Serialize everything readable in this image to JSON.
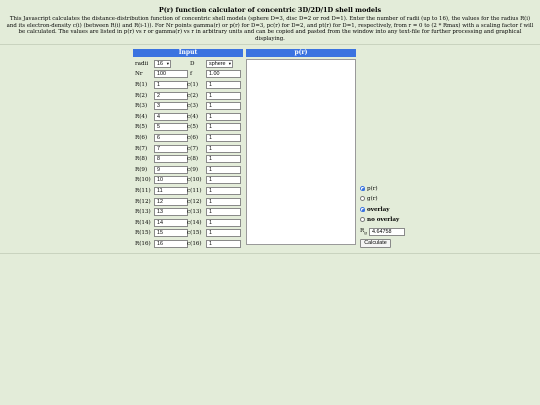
{
  "page": {
    "title": "P(r) function calculator of concentric 3D/2D/1D shell models",
    "description": "This Javascript calculates the distance-distribution function of concentric shell models (sphere D=3, disc D=2 or rod D=1). Enter the number of radii (up to 16), the values for the radius R(i) and its electron-density c(i) (between R(i) and R(i-1)). For Nr points gamma(r) or p(r) for D=3, pc(r) for D=2, and pt(r) for D=1, respectively, from r = 0 to (2 * Rmax) with a scaling factor f will be calculated. The values are listed in p(r) vs r or gamma(r) vs r in arbitrary units and can be copied and pasted from the window into any text-file for further processing and graphical displaying."
  },
  "input": {
    "header": "Input",
    "radii_label": "radii",
    "radii_value": "16",
    "d_label": "D",
    "d_value": "sphere",
    "nr_label": "Nr",
    "nr_value": "100",
    "f_label": "f",
    "f_value": "1.00",
    "rows": [
      {
        "r_label": "R(1)",
        "r_value": "1",
        "c_label": "c(1)",
        "c_value": "1"
      },
      {
        "r_label": "R(2)",
        "r_value": "2",
        "c_label": "c(2)",
        "c_value": "1"
      },
      {
        "r_label": "R(3)",
        "r_value": "3",
        "c_label": "c(3)",
        "c_value": "1"
      },
      {
        "r_label": "R(4)",
        "r_value": "4",
        "c_label": "c(4)",
        "c_value": "1"
      },
      {
        "r_label": "R(5)",
        "r_value": "5",
        "c_label": "c(5)",
        "c_value": "1"
      },
      {
        "r_label": "R(6)",
        "r_value": "6",
        "c_label": "c(6)",
        "c_value": "1"
      },
      {
        "r_label": "R(7)",
        "r_value": "7",
        "c_label": "c(7)",
        "c_value": "1"
      },
      {
        "r_label": "R(8)",
        "r_value": "8",
        "c_label": "c(8)",
        "c_value": "1"
      },
      {
        "r_label": "R(9)",
        "r_value": "9",
        "c_label": "c(9)",
        "c_value": "1"
      },
      {
        "r_label": "R(10)",
        "r_value": "10",
        "c_label": "c(10)",
        "c_value": "1"
      },
      {
        "r_label": "R(11)",
        "r_value": "11",
        "c_label": "c(11)",
        "c_value": "1"
      },
      {
        "r_label": "R(12)",
        "r_value": "12",
        "c_label": "c(12)",
        "c_value": "1"
      },
      {
        "r_label": "R(13)",
        "r_value": "13",
        "c_label": "c(13)",
        "c_value": "1"
      },
      {
        "r_label": "R(14)",
        "r_value": "14",
        "c_label": "c(14)",
        "c_value": "1"
      },
      {
        "r_label": "R(15)",
        "r_value": "15",
        "c_label": "c(15)",
        "c_value": "1"
      },
      {
        "r_label": "R(16)",
        "r_value": "16",
        "c_label": "c(16)",
        "c_value": "1"
      }
    ]
  },
  "output": {
    "header": "p(r)"
  },
  "options": {
    "pr_label": "p(r)",
    "gr_label": "g(r)",
    "overlay_label": "overlay",
    "no_overlay_label": "no overlay",
    "pr_selected": true,
    "overlay_selected": true,
    "rg_label": "R",
    "rg_sub": "g",
    "rg_value": "4.64758",
    "calculate_label": "Calculate"
  },
  "colors": {
    "background": "#e3ecd9",
    "header_blue": "#3b73e0"
  }
}
